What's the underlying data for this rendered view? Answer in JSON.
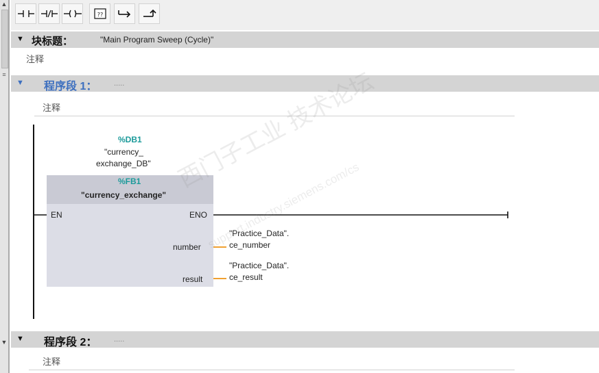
{
  "toolbar": {
    "buttons": [
      {
        "name": "no-contact-button",
        "glyph": "⊣⊢"
      },
      {
        "name": "nc-contact-button",
        "glyph": "⊣/⊢"
      },
      {
        "name": "coil-button",
        "glyph": "—()—"
      },
      {
        "name": "empty-box-button",
        "glyph": "??"
      },
      {
        "name": "open-branch-button",
        "glyph": "↦"
      },
      {
        "name": "close-branch-button",
        "glyph": "⤴"
      }
    ]
  },
  "block": {
    "title_label": "块标题：",
    "title_value": "\"Main Program Sweep (Cycle)\"",
    "comment": "注释"
  },
  "networks": [
    {
      "label": "程序段 1：",
      "dots": ".....",
      "comment": "注释",
      "color": "#3d6fbf"
    },
    {
      "label": "程序段 2：",
      "dots": ".....",
      "comment": "注释",
      "color": "#222222"
    }
  ],
  "fb": {
    "db_ref": "%DB1",
    "db_name_line1": "\"currency_",
    "db_name_line2": "exchange_DB\"",
    "fb_ref": "%FB1",
    "fb_name": "\"currency_exchange\"",
    "en": "EN",
    "eno": "ENO",
    "pins": [
      {
        "pin": "number",
        "operand_line1": "\"Practice_Data\".",
        "operand_line2": "ce_number"
      },
      {
        "pin": "result",
        "operand_line1": "\"Practice_Data\".",
        "operand_line2": "ce_result"
      }
    ]
  },
  "colors": {
    "accent": "#3d6fbf",
    "teal": "#1b9a9a",
    "wire": "#f0a030",
    "block_fill": "#dcdde6",
    "header_fill": "#c9cad4"
  },
  "watermark": {
    "text1": "西门子工业 技术论坛",
    "text2": "support.industry.siemens.com/cs"
  }
}
